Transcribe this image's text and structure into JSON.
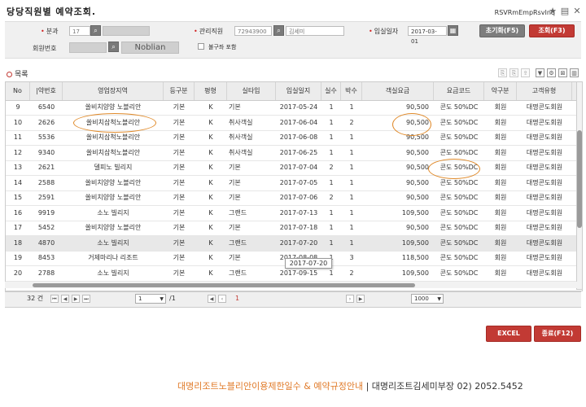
{
  "header": {
    "title": "당당직원별 예약조회.",
    "screen_id": "RSVRmEmpRsvInq"
  },
  "filters": {
    "division_label": "분과",
    "division_value": "17",
    "staff_label": "관리직원",
    "staff_code": "72943900",
    "staff_name": "김세미",
    "checkin_label": "입실일자",
    "checkin_date": "2017-03-01",
    "member_label": "회원번호",
    "member_brand": "Noblian",
    "checkbox_label": "불구좌 포함",
    "reset_button": "초기화(F5)",
    "search_button": "조회(F3)"
  },
  "list": {
    "section_title": "목록",
    "columns": [
      "No",
      "|약번호",
      "영업장지역",
      "등구분",
      "평형",
      "실타입",
      "입실일지",
      "실수",
      "박수",
      "객실요금",
      "요금코드",
      "약구분",
      "고객유형"
    ],
    "rows": [
      [
        "9",
        "6540",
        "쏠비치양양 노블리안",
        "기본",
        "K",
        "기본",
        "2017-05-24",
        "1",
        "1",
        "90,500",
        "콘도 50%DC",
        "회원",
        "대명콘도회원"
      ],
      [
        "10",
        "2626",
        "쏠비치삼척노블리안",
        "기본",
        "K",
        "취사객실",
        "2017-06-04",
        "1",
        "2",
        "90,500",
        "콘도 50%DC",
        "회원",
        "대명콘도회원"
      ],
      [
        "11",
        "5536",
        "쏠비치삼척노블리안",
        "기본",
        "K",
        "취사객실",
        "2017-06-08",
        "1",
        "1",
        "90,500",
        "콘도 50%DC",
        "회원",
        "대명콘도회원"
      ],
      [
        "12",
        "9340",
        "쏠비치삼척노블리안",
        "기본",
        "K",
        "취사객실",
        "2017-06-25",
        "1",
        "1",
        "90,500",
        "콘도 50%DC",
        "회원",
        "대명콘도회원"
      ],
      [
        "13",
        "2621",
        "델피노 빌리지",
        "기본",
        "K",
        "기본",
        "2017-07-04",
        "2",
        "1",
        "90,500",
        "콘도 50%DC",
        "회원",
        "대명콘도회원"
      ],
      [
        "14",
        "2588",
        "쏠비치양양 노블리안",
        "기본",
        "K",
        "기본",
        "2017-07-05",
        "1",
        "1",
        "90,500",
        "콘도 50%DC",
        "회원",
        "대명콘도회원"
      ],
      [
        "15",
        "2591",
        "쏠비치양양 노블리안",
        "기본",
        "K",
        "기본",
        "2017-07-06",
        "2",
        "1",
        "90,500",
        "콘도 50%DC",
        "회원",
        "대명콘도회원"
      ],
      [
        "16",
        "9919",
        "소노 빌리지",
        "기본",
        "K",
        "그랜드",
        "2017-07-13",
        "1",
        "1",
        "109,500",
        "콘도 50%DC",
        "회원",
        "대명콘도회원"
      ],
      [
        "17",
        "5452",
        "쏠비치양양 노블리안",
        "기본",
        "K",
        "기본",
        "2017-07-18",
        "1",
        "1",
        "90,500",
        "콘도 50%DC",
        "회원",
        "대명콘도회원"
      ],
      [
        "18",
        "4870",
        "소노 빌리지",
        "기본",
        "K",
        "그랜드",
        "2017-07-20",
        "1",
        "1",
        "109,500",
        "콘도 50%DC",
        "회원",
        "대명콘도회원"
      ],
      [
        "19",
        "8453",
        "거제마리나 리조트",
        "기본",
        "K",
        "기본",
        "2017-08-08",
        "1",
        "3",
        "118,500",
        "콘도 50%DC",
        "회원",
        "대명콘도회원"
      ],
      [
        "20",
        "2788",
        "소노 빌리지",
        "기본",
        "K",
        "그랜드",
        "2017-09-15",
        "1",
        "2",
        "109,500",
        "콘도 50%DC",
        "회원",
        "대명콘도회원"
      ]
    ],
    "selected_row": "18",
    "tooltip": "2017-07-20"
  },
  "pager": {
    "total": "32 건",
    "page": "1",
    "page_total": "/1",
    "current_page": "1",
    "page_size": "1000"
  },
  "actions": {
    "excel_button": "EXCEL",
    "close_button": "종료(F12)"
  },
  "footer": {
    "highlight": "대명리조트노블리안이용제한일수 & 예약규정안내",
    "contact": " | 대명리조트김세미부장 02) 2052.5452"
  },
  "colors": {
    "accent_red": "#c23a34",
    "annotation_orange": "#e08a2a"
  }
}
